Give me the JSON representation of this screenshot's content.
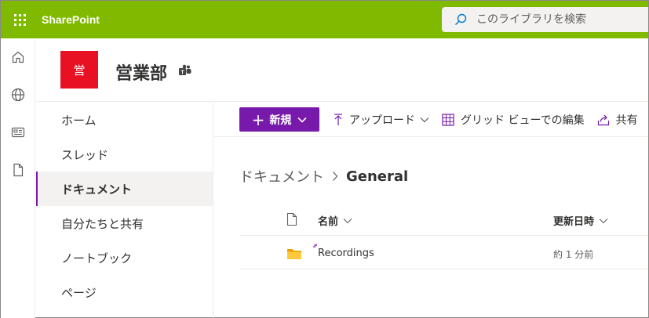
{
  "suite": {
    "app_name": "SharePoint",
    "search_placeholder": "このライブラリを検索",
    "accent_color": "#7fba00"
  },
  "site": {
    "logo_text": "営",
    "title": "営業部",
    "logo_color": "#e81123"
  },
  "nav": {
    "items": [
      {
        "label": "ホーム"
      },
      {
        "label": "スレッド"
      },
      {
        "label": "ドキュメント",
        "selected": true
      },
      {
        "label": "自分たちと共有"
      },
      {
        "label": "ノートブック"
      },
      {
        "label": "ページ"
      }
    ]
  },
  "commands": {
    "new_label": "新規",
    "upload_label": "アップロード",
    "grid_edit_label": "グリッド ビューでの編集",
    "share_label": "共有",
    "brand_color": "#7719aa"
  },
  "breadcrumb": {
    "parent": "ドキュメント",
    "current": "General"
  },
  "list": {
    "columns": {
      "name": "名前",
      "modified": "更新日時"
    },
    "rows": [
      {
        "name": "Recordings",
        "modified": "約 1 分前",
        "icon": "folder-icon"
      }
    ]
  }
}
